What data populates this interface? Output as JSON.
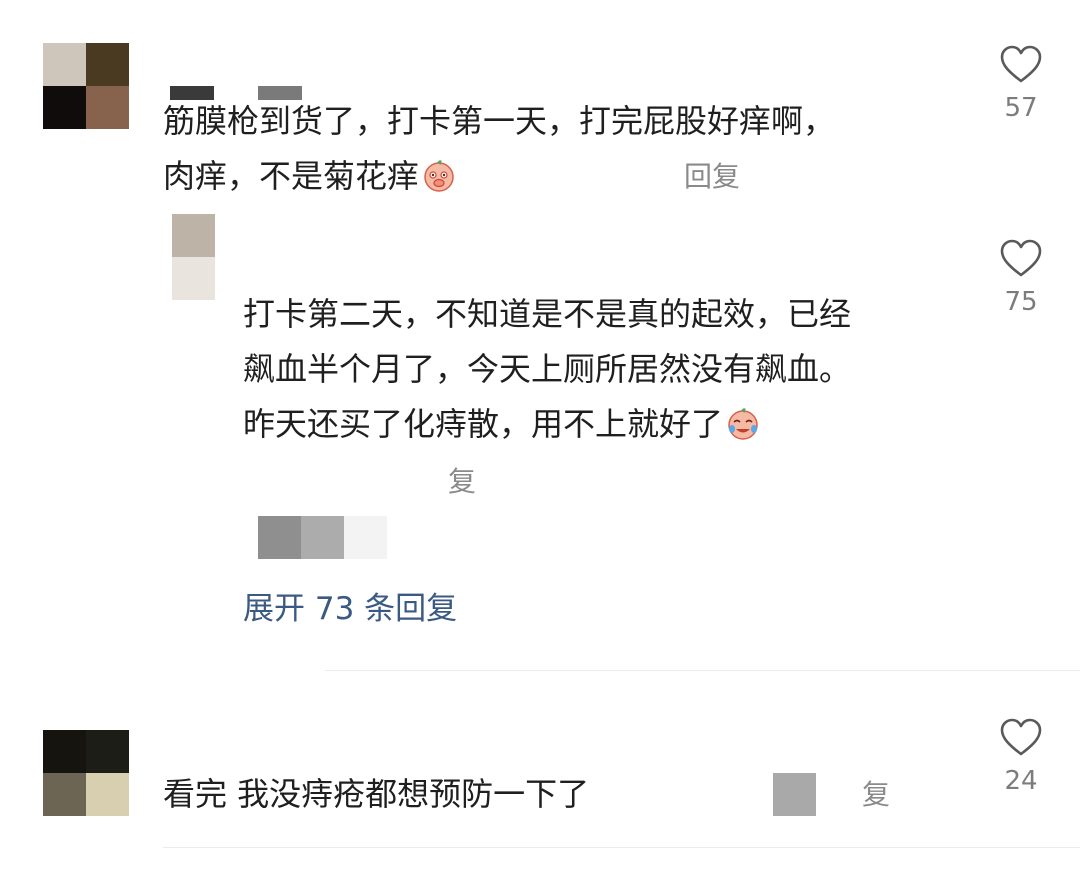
{
  "comments": [
    {
      "text_line1": "筋膜枪到货了，打卡第一天，打完屁股好痒啊，",
      "text_line2": "肉痒，不是菊花痒",
      "emoji_icon": "shy-face-emoji",
      "reply_label": "回复",
      "likes": "57",
      "replies": [
        {
          "text_line1": "打卡第二天，不知道是不是真的起效，已经",
          "text_line2": "飙血半个月了，今天上厕所居然没有飙血。",
          "text_line3": "昨天还买了化痔散，用不上就好了",
          "emoji_icon": "crying-laughing-emoji",
          "reply_label": "复",
          "likes": "75"
        }
      ],
      "expand_label": "展开 73 条回复"
    },
    {
      "text": "看完 我没痔疮都想预防一下了",
      "reply_label": "复",
      "likes": "24"
    }
  ],
  "colors": {
    "text": "#1f1f1f",
    "muted": "#8a8a8a",
    "link": "#3b5a83",
    "divider": "#ececec"
  },
  "icons": {
    "like": "heart-outline-icon"
  }
}
